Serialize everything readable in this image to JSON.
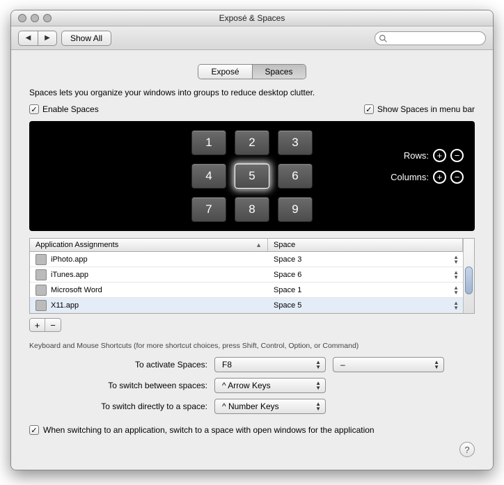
{
  "window": {
    "title": "Exposé & Spaces"
  },
  "toolbar": {
    "show_all": "Show All",
    "search_placeholder": ""
  },
  "tabs": {
    "expose": "Exposé",
    "spaces": "Spaces"
  },
  "description": "Spaces lets you organize your windows into groups to reduce desktop clutter.",
  "checks": {
    "enable": "Enable Spaces",
    "menubar": "Show Spaces in menu bar",
    "switch_app": "When switching to an application, switch to a space with open windows for the application"
  },
  "preview": {
    "cells": [
      "1",
      "2",
      "3",
      "4",
      "5",
      "6",
      "7",
      "8",
      "9"
    ],
    "active_index": 4,
    "rows_label": "Rows:",
    "cols_label": "Columns:"
  },
  "table": {
    "col_app": "Application Assignments",
    "col_space": "Space",
    "rows": [
      {
        "name": "iPhoto.app",
        "space": "Space 3"
      },
      {
        "name": "iTunes.app",
        "space": "Space 6"
      },
      {
        "name": "Microsoft Word",
        "space": "Space 1"
      },
      {
        "name": "X11.app",
        "space": "Space 5"
      }
    ]
  },
  "shortcuts": {
    "title": "Keyboard and Mouse Shortcuts (for more shortcut choices, press Shift, Control, Option, or Command)",
    "activate_label": "To activate Spaces:",
    "activate_value": "F8",
    "activate_mouse": "–",
    "switch_label": "To switch between spaces:",
    "switch_value": "^ Arrow Keys",
    "direct_label": "To switch directly to a space:",
    "direct_value": "^ Number Keys"
  },
  "help": "?"
}
